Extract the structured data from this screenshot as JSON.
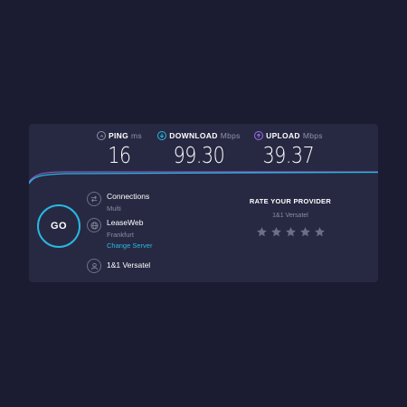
{
  "metrics": {
    "ping": {
      "label": "PING",
      "unit": "ms",
      "value": "16",
      "icon": "ping-icon",
      "color": "#9193a8"
    },
    "download": {
      "label": "DOWNLOAD",
      "unit": "Mbps",
      "value": "99.30",
      "icon": "download-arrow-icon",
      "color": "#29b8e0"
    },
    "upload": {
      "label": "UPLOAD",
      "unit": "Mbps",
      "value": "39.37",
      "icon": "upload-arrow-icon",
      "color": "#9d6ce8"
    }
  },
  "go_button": {
    "label": "GO"
  },
  "connections": {
    "title": "Connections",
    "value": "Multi",
    "icon": "connections-icon"
  },
  "server": {
    "name": "LeaseWeb",
    "location": "Frankfurt",
    "change_link": "Change Server",
    "icon": "globe-icon"
  },
  "provider": {
    "name": "1&1 Versatel",
    "icon": "user-icon"
  },
  "rating": {
    "title": "RATE YOUR PROVIDER",
    "provider": "1&1 Versatel",
    "max_stars": 5,
    "selected_stars": 0
  },
  "colors": {
    "background": "#1b1c31",
    "card": "#272943",
    "accent_blue": "#29b8e0",
    "accent_purple": "#9d6ce8",
    "star_inactive": "#6c6f88"
  }
}
